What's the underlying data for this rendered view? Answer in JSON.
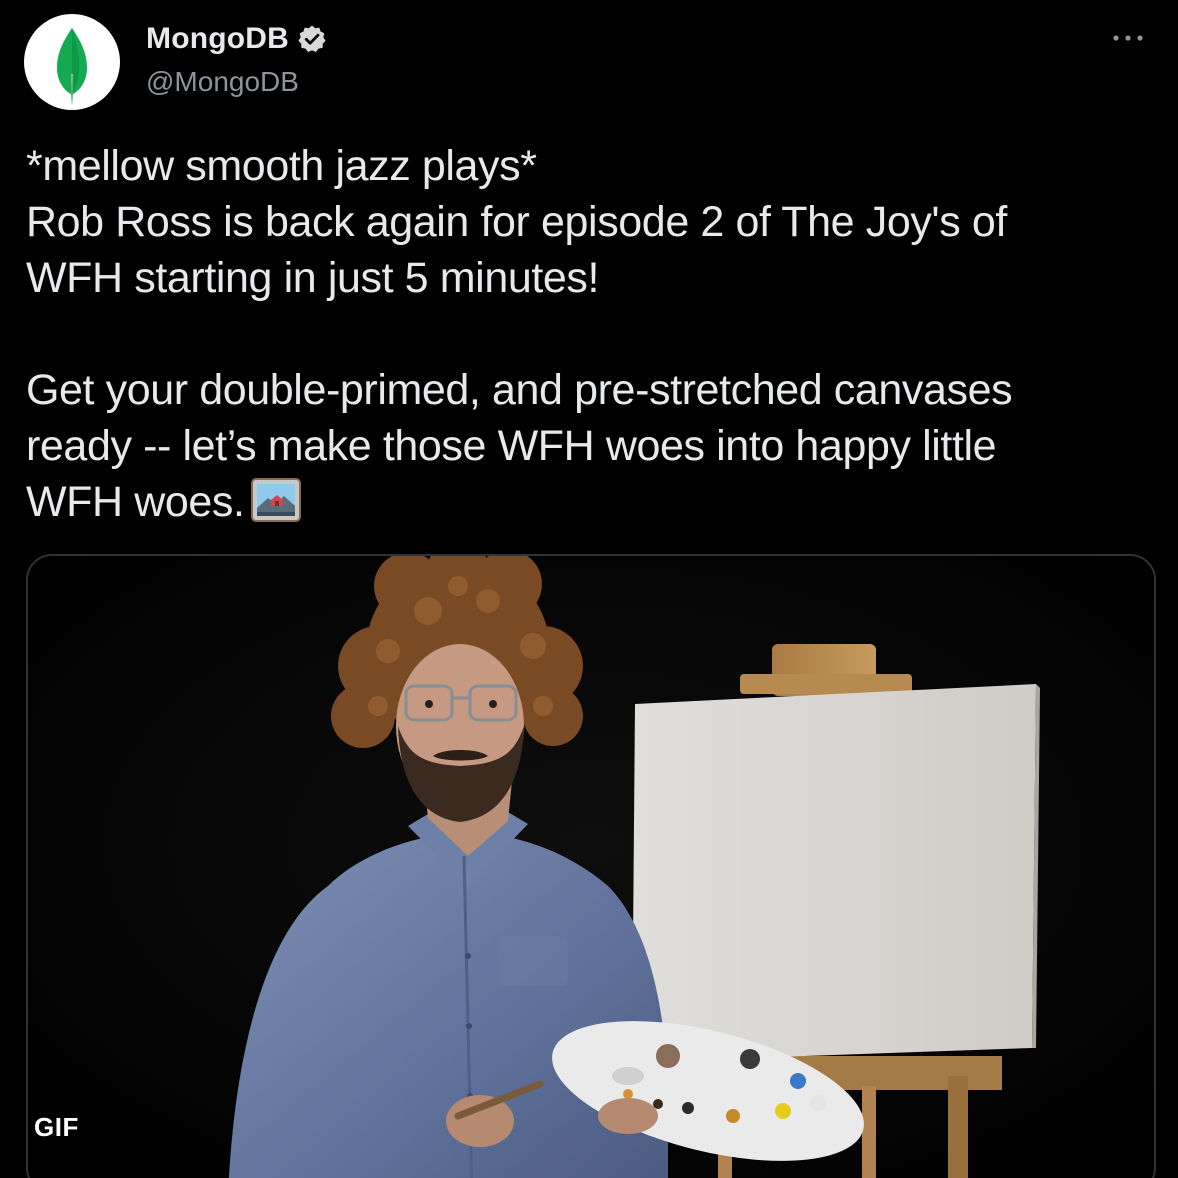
{
  "account": {
    "display_name": "MongoDB",
    "handle": "@MongoDB",
    "verified": true,
    "avatar_icon": "mongodb-leaf-icon"
  },
  "tweet": {
    "lines_para1": [
      "*mellow smooth jazz plays*",
      "Rob Ross is back again for episode 2 of The Joy's of",
      "WFH starting in just 5 minutes!"
    ],
    "lines_para2": [
      "Get your double-primed, and pre-stretched canvases",
      "ready -- let’s make those WFH woes into happy little",
      "WFH woes."
    ],
    "emoji": "framed-picture-emoji"
  },
  "media": {
    "badge": "GIF"
  },
  "colors": {
    "background": "#000000",
    "text": "#e7e9ea",
    "secondary_text": "#8b949a",
    "leaf_green": "#13aa52",
    "verified_badge": "#d9d9d9"
  }
}
